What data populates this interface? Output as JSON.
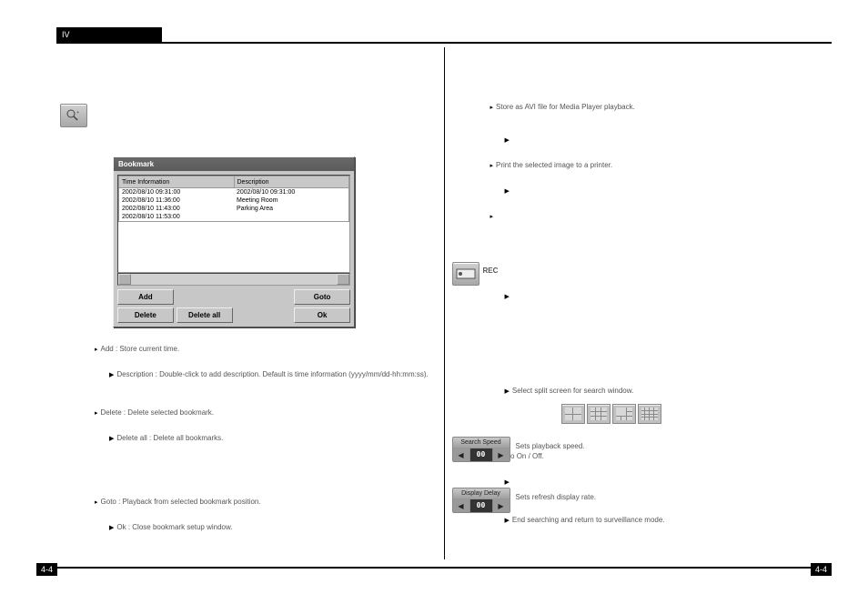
{
  "header": {
    "title": "IV"
  },
  "pageNumber": "4-4",
  "dialog": {
    "title": "Bookmark",
    "columns": [
      "Time Information",
      "Description"
    ],
    "rows": [
      {
        "time": "2002/08/10 09:31:00",
        "desc": "2002/08/10 09:31:00"
      },
      {
        "time": "2002/08/10 11:36:00",
        "desc": "Meeting Room"
      },
      {
        "time": "2002/08/10 11:43:00",
        "desc": "Parking Area"
      },
      {
        "time": "2002/08/10 11:53:00",
        "desc": ""
      }
    ],
    "buttons": {
      "add": "Add",
      "delete": "Delete",
      "deleteAll": "Delete all",
      "goto": "Goto",
      "ok": "Ok"
    }
  },
  "searchSpeed": {
    "label": "Search Speed",
    "value": "00"
  },
  "displayDelay": {
    "label": "Display Delay",
    "value": "00"
  },
  "recIcon": "REC",
  "paragraphs": {
    "p1": "Add : Store current time.",
    "p2": "Delete : Delete selected bookmark.",
    "p3": "Description : Double-click to add description. Default is time information (yyyy/mm/dd-hh:mm:ss).",
    "p4": "Delete all : Delete all bookmarks.",
    "p5": "Goto : Playback from selected bookmark position.",
    "p6": "Ok : Close bookmark setup window.",
    "r1": "Store as AVI file for Media Player playback.",
    "r2": "Print the selected image to a printer.",
    "r3": "Sets playback speed.",
    "r4": "Sets refresh display rate.",
    "r5": "Select split screen for search window.",
    "r6": "Audio On / Off.",
    "r7": "End searching and return to surveillance mode."
  }
}
